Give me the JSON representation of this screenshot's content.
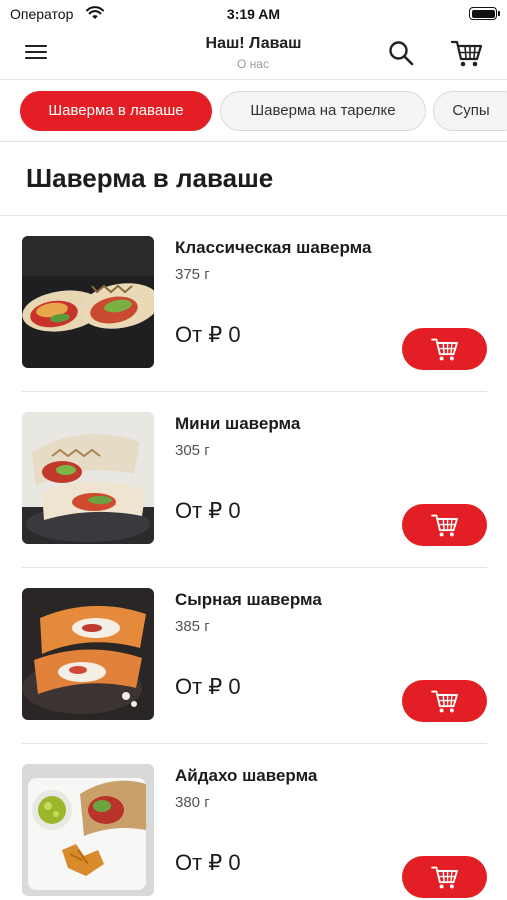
{
  "status_bar": {
    "carrier": "Оператор",
    "time": "3:19 AM"
  },
  "header": {
    "title": "Наш! Лаваш",
    "subtitle": "О нас"
  },
  "tabs": [
    {
      "label": "Шаверма в лаваше",
      "active": true
    },
    {
      "label": "Шаверма на тарелке",
      "active": false
    },
    {
      "label": "Супы",
      "active": false
    }
  ],
  "section": {
    "title": "Шаверма в лаваше"
  },
  "products": [
    {
      "name": "Классическая шаверма",
      "weight": "375 г",
      "price": "От ₽ 0"
    },
    {
      "name": "Мини шаверма",
      "weight": "305 г",
      "price": "От ₽ 0"
    },
    {
      "name": "Сырная шаверма",
      "weight": "385 г",
      "price": "От ₽ 0"
    },
    {
      "name": "Айдахо шаверма",
      "weight": "380 г",
      "price": "От ₽ 0"
    }
  ],
  "icons": {
    "menu": "hamburger-menu-icon",
    "search": "search-icon",
    "cart": "shopping-cart-icon",
    "add_to_cart": "cart-add-icon"
  },
  "colors": {
    "accent": "#e31e24",
    "divider": "#e4e4e4"
  }
}
